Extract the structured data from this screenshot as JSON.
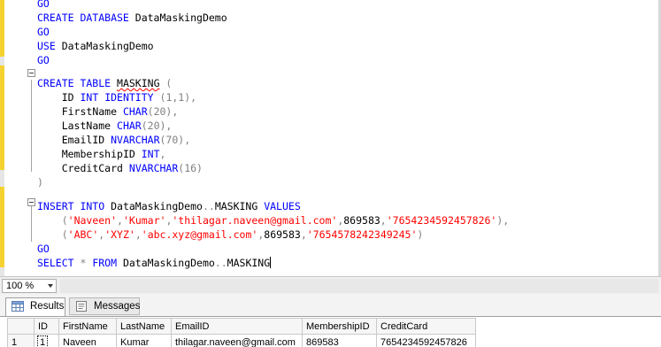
{
  "editor": {
    "line_go1": "GO",
    "line_create_db_kw": "CREATE DATABASE",
    "line_create_db_name": " DataMaskingDemo",
    "line_go2": "GO",
    "line_use_kw": "USE",
    "line_use_name": " DataMaskingDemo",
    "line_go3": "GO",
    "line_create_table_kw": "CREATE TABLE",
    "line_create_table_name": "MASKING",
    "line_create_table_paren": " (",
    "col_id": "ID",
    "col_id_type": "INT IDENTITY",
    "col_id_args": "(1,1),",
    "col_first": "FirstName",
    "col_first_type": "CHAR",
    "col_first_args": "(20),",
    "col_last": "LastName",
    "col_last_type": "CHAR",
    "col_last_args": "(20),",
    "col_email": "EmailID",
    "col_email_type": "NVARCHAR",
    "col_email_args": "(70),",
    "col_member": "MembershipID",
    "col_member_type": "INT",
    "col_member_args": ",",
    "col_credit": "CreditCard",
    "col_credit_type": "NVARCHAR",
    "col_credit_args": "(16)",
    "close_paren": ")",
    "insert_kw": "INSERT INTO",
    "insert_target": " DataMaskingDemo",
    "insert_dots": "..",
    "insert_table": "MASKING",
    "insert_values_kw": " VALUES",
    "row1_open": "(",
    "row1_s1": "'Naveen'",
    "row1_s2": "'Kumar'",
    "row1_s3": "'thilagar.naveen@gmail.com'",
    "row1_num": "869583",
    "row1_s4": "'7654234592457826'",
    "row1_close": "),",
    "row2_open": "(",
    "row2_s1": "'ABC'",
    "row2_s2": "'XYZ'",
    "row2_s3": "'abc.xyz@gmail.com'",
    "row2_num": "869583",
    "row2_s4": "'7654578242349245'",
    "row2_close": ")",
    "go_final": "GO",
    "select_kw": "SELECT",
    "select_star": " * ",
    "select_from": "FROM",
    "select_target": " DataMaskingDemo",
    "select_dots": "..",
    "select_table": "MASKING"
  },
  "status": {
    "zoom": "100 %"
  },
  "tabs": {
    "results": "Results",
    "messages": "Messages"
  },
  "grid": {
    "headers": [
      "ID",
      "FirstName",
      "LastName",
      "EmailID",
      "MembershipID",
      "CreditCard"
    ],
    "rows": [
      {
        "rownum": "1",
        "cells": [
          "1",
          "Naveen",
          "Kumar",
          "thilagar.naveen@gmail.com",
          "869583",
          "7654234592457826"
        ]
      }
    ]
  },
  "colors": {
    "keyword": "#0000ff",
    "string": "#ff0000",
    "operator": "#808080",
    "function": "#ff00ff",
    "change_bar": "#f5d230"
  }
}
